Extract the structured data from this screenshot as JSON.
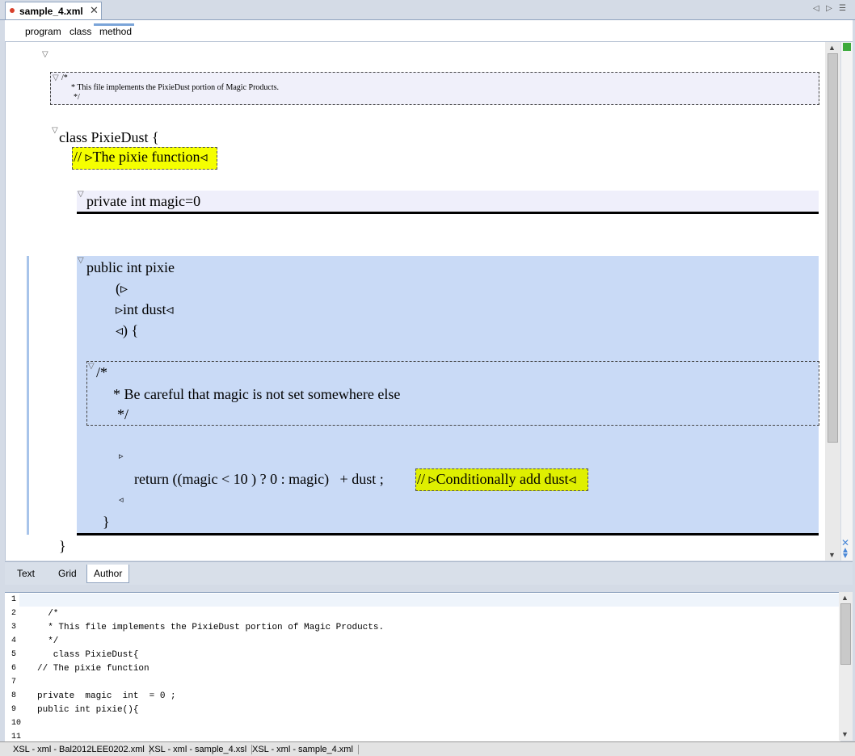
{
  "editor_tab": {
    "title": "sample_4.xml",
    "close_glyph": "✕"
  },
  "breadcrumb": [
    "program",
    "class",
    "method"
  ],
  "author_view": {
    "header_comment": [
      "/*",
      "* This file implements the PixieDust portion of Magic Products.",
      "*/"
    ],
    "class_line": "class PixieDust {",
    "comment_pixie": "// ▹The pixie function◃",
    "field_decl": "private int magic=0",
    "method_sig": "public int pixie",
    "paren_open": "(▹",
    "param": "▹int dust◃",
    "paren_close": "◃) {",
    "method_comment": [
      "/*",
      "* Be careful that magic is not set somewhere else",
      "*/"
    ],
    "return_marker_start": "▹",
    "return_stmt": "return ((magic < 10 ) ? 0 : magic)   + dust ;",
    "comment_cond": "// ▹Conditionally add dust◃",
    "return_marker_end": "◃",
    "method_close": "}",
    "class_close": "}"
  },
  "mode_tabs": [
    "Text",
    "Grid",
    "Author"
  ],
  "active_mode": "Author",
  "source_lines": [
    {
      "n": "1",
      "code": ""
    },
    {
      "n": "2",
      "code": "  /*"
    },
    {
      "n": "3",
      "code": "  * This file implements the PixieDust portion of Magic Products."
    },
    {
      "n": "4",
      "code": "  */"
    },
    {
      "n": "5",
      "code": "   class PixieDust{"
    },
    {
      "n": "6",
      "code": "// The pixie function"
    },
    {
      "n": "7",
      "code": ""
    },
    {
      "n": "8",
      "code": "private  magic  int  = 0 ;"
    },
    {
      "n": "9",
      "code": "public int pixie(){"
    },
    {
      "n": "10",
      "code": ""
    },
    {
      "n": "11",
      "code": ""
    }
  ],
  "doc_tabs": [
    "XSL - xml - Bal2012LEE0202.xml",
    "XSL - xml - sample_4.xsl",
    "XSL - xml - sample_4.xml"
  ],
  "colors": {
    "status_ok": "#3caa3c",
    "method_bg": "#c9daf6",
    "comment_highlight": "#f5ff00"
  }
}
